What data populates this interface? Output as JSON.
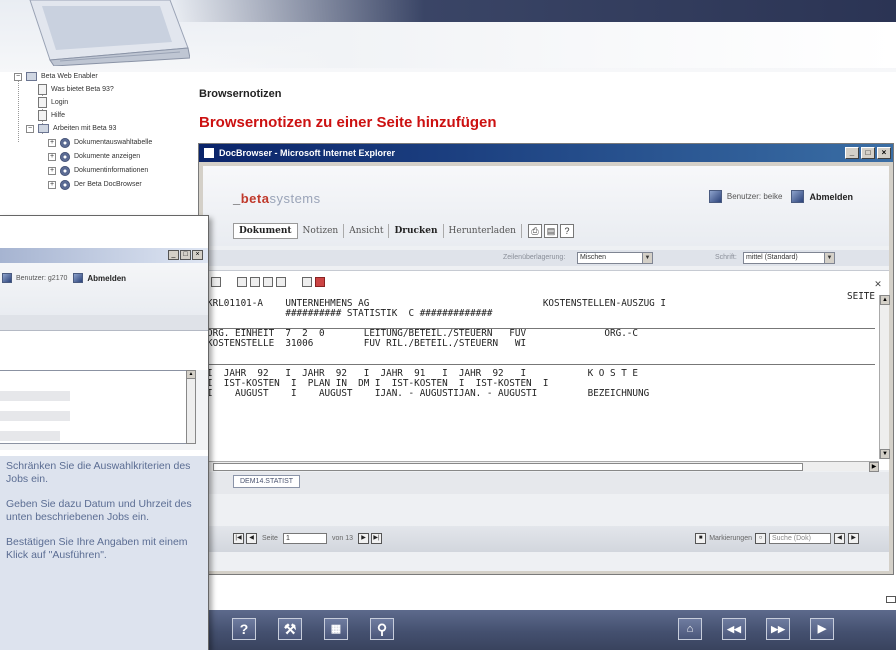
{
  "tree": {
    "items": [
      {
        "label": "Beta Web Enabler"
      },
      {
        "label": "Was bietet Beta 93?"
      },
      {
        "label": "Login"
      },
      {
        "label": "Hilfe"
      },
      {
        "label": "Arbeiten mit Beta 93"
      },
      {
        "label": "Dokumentauswahltabelle"
      },
      {
        "label": "Dokumente anzeigen"
      },
      {
        "label": "Dokumentinformationen"
      },
      {
        "label": "Der Beta DocBrowser"
      }
    ]
  },
  "page": {
    "section_title": "Browsernotizen",
    "heading": "Browsernotizen zu einer Seite hinzufügen"
  },
  "ie_window": {
    "title": "DocBrowser - Microsoft Internet Explorer",
    "logo_dash": "_",
    "logo_beta": "beta",
    "logo_rest": "systems",
    "user_label": "Benutzer: beike",
    "logout": "Abmelden",
    "menu": {
      "dokument": "Dokument",
      "notizen": "Notizen",
      "ansicht": "Ansicht",
      "drucken": "Drucken",
      "herunterladen": "Herunterladen"
    },
    "options": {
      "zeilen_label": "Zeilenüberlagerung:",
      "zeilen_value": "Mischen",
      "schrift_label": "Schrift:",
      "schrift_value": "mittel (Standard)"
    },
    "report_lines": [
      "KRL01101-A    UNTERNEHMENS AG                               KOSTENSTELLEN-AUSZUG I",
      "              ########## STATISTIK  C #############",
      "",
      "ORG. EINHEIT  7  2  0       LEITUNG/BETEIL./STEUERN   FUV              ORG.-C",
      "KOSTENSTELLE  31006         FUV RIL./BETEIL./STEUERN   WI",
      "",
      "",
      "I  JAHR  92   I  JAHR  92   I  JAHR  91   I  JAHR  92   I           K O S T E",
      "I  IST-KOSTEN  I  PLAN IN  DM I  IST-KOSTEN  I  IST-KOSTEN  I",
      "I    AUGUST    I    AUGUST    IJAN. - AUGUSTIJAN. - AUGUSTI         BEZEICHNUNG"
    ],
    "report_seite": "SEITE",
    "tab_label": "DEM14.STATIST",
    "pager": {
      "seite_label": "Seite",
      "page_value": "1",
      "of_label": "von 13"
    },
    "markierungen": "Markierungen",
    "suche_placeholder": "Suche (Dok)"
  },
  "overlay": {
    "user_label": "Benutzer: g2170",
    "logout": "Abmelden",
    "help": [
      "Schränken Sie die Auswahlkriterien des Jobs ein.",
      "Geben Sie dazu Datum und Uhrzeit des unten beschriebenen Jobs ein.",
      "Bestätigen Sie Ihre Angaben mit einem Klick auf \"Ausführen\"."
    ]
  },
  "bottombar": {
    "help_icon": "?",
    "tools_icon": "wrench-icon",
    "calc_icon": "calculator-icon",
    "search_icon": "magnifier-icon",
    "home_icon": "home-icon",
    "back_label": "◀◀",
    "fwd_label": "▶▶",
    "play_label": "▶"
  },
  "colors": {
    "heading_red": "#cc1111",
    "titlebar_blue": "#0a246a",
    "bottombar": "#44506f",
    "help_text": "#5b6d93"
  }
}
